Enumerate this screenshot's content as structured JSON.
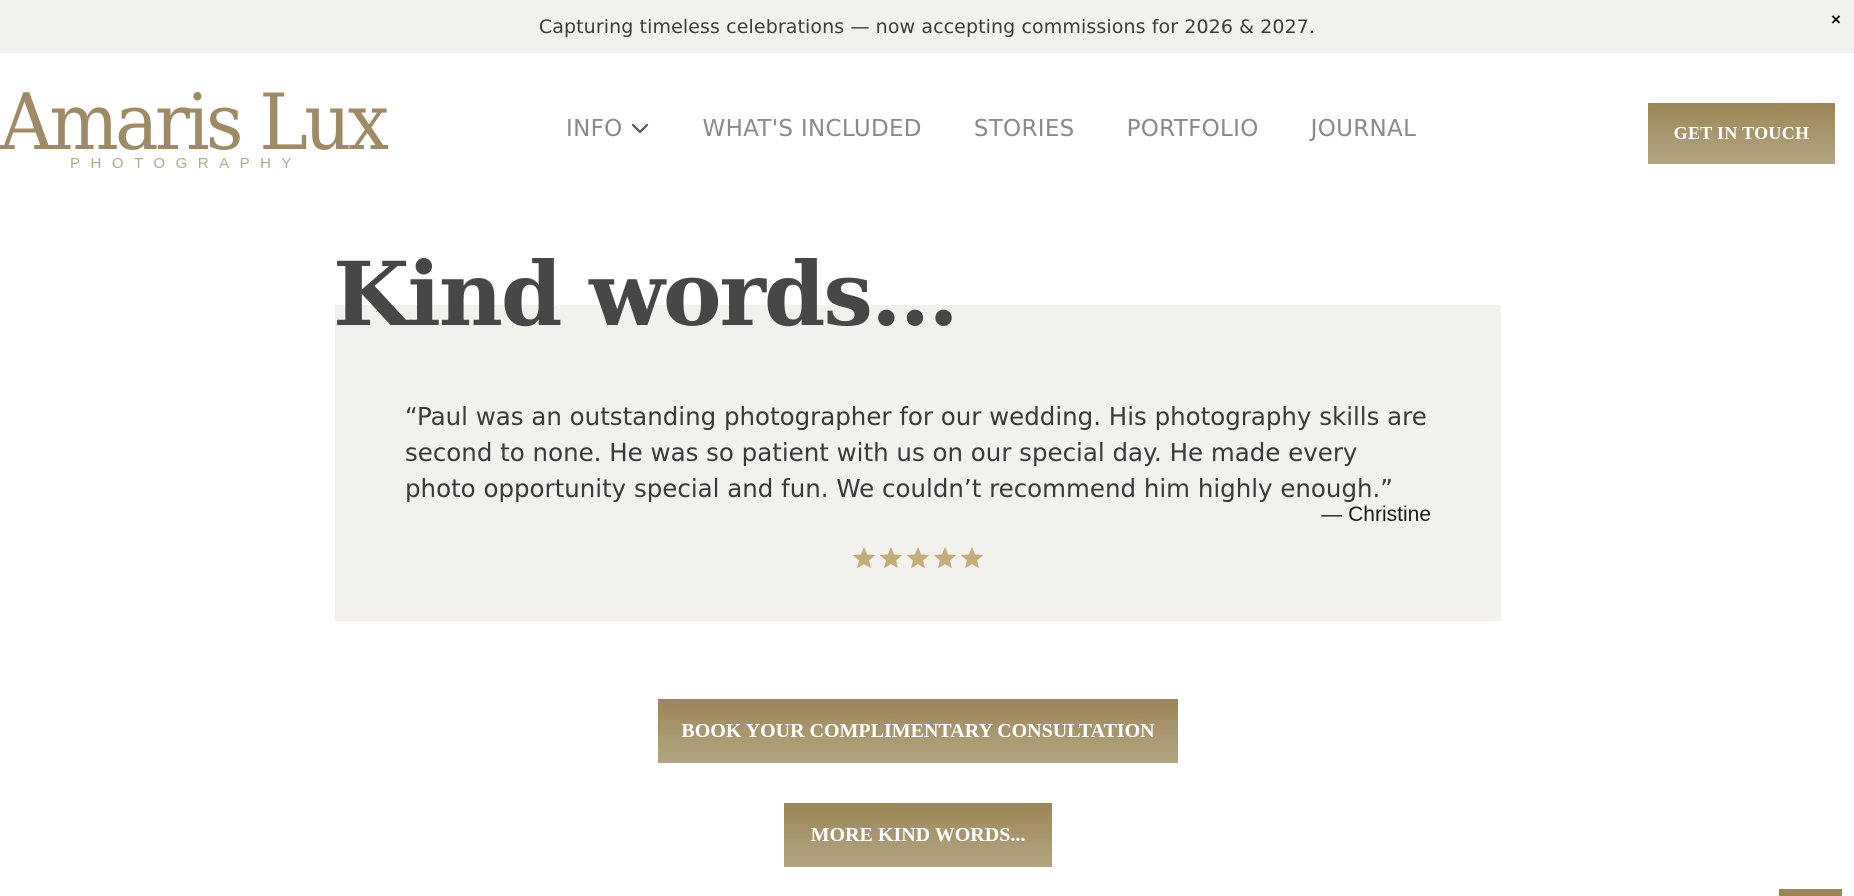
{
  "announcement": {
    "text": "Capturing timeless celebrations — now accepting commissions for 2026 & 2027.",
    "close_label": "×"
  },
  "brand": {
    "name": "Amaris Lux",
    "tagline": "PHOTOGRAPHY",
    "color": "#9e8a64"
  },
  "nav": {
    "items": [
      {
        "label": "INFO",
        "has_dropdown": true,
        "icon": "chevron-down-icon"
      },
      {
        "label": "WHAT'S INCLUDED"
      },
      {
        "label": "STORIES"
      },
      {
        "label": "PORTFOLIO"
      },
      {
        "label": "JOURNAL"
      }
    ],
    "cta_label": "GET IN TOUCH"
  },
  "testimonials": {
    "heading": "Kind words...",
    "quote": "“Paul was an outstanding photographer for our wedding. His photography skills are second to none. He was so patient with us on our special day. He made every photo opportunity special and fun. We couldn’t recommend him highly enough.”",
    "author": "— Christine",
    "rating": 5,
    "rating_max": 5,
    "star_color": "#c4ad7a"
  },
  "actions": {
    "consult_label": "BOOK YOUR COMPLIMENTARY CONSULTATION",
    "more_label": "MORE KIND WORDS..."
  },
  "colors": {
    "accent_top": "#9c8556",
    "accent_bottom": "#b3a683",
    "panel_bg": "#f2f1ed"
  }
}
